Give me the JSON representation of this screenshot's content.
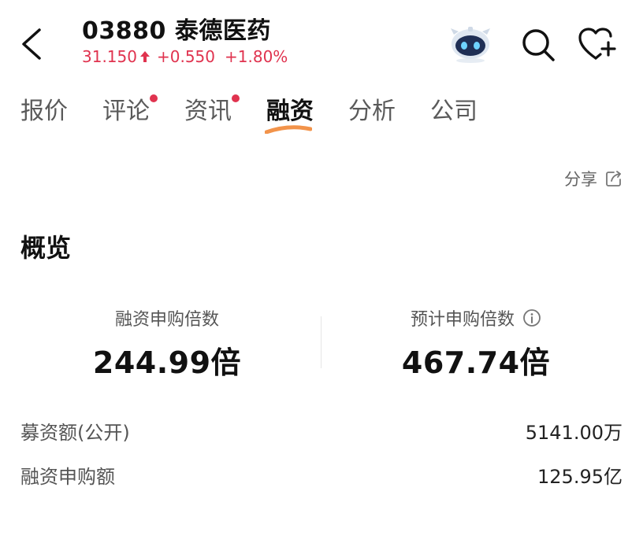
{
  "header": {
    "stock_code": "03880",
    "stock_name": "泰德医药",
    "price": "31.150",
    "change": "+0.550",
    "change_pct": "+1.80%",
    "quote_color": "#e0334f"
  },
  "icons": {
    "back": "chevron-left-icon",
    "assistant": "robot-assistant-icon",
    "search": "search-icon",
    "favorite": "heart-plus-icon",
    "share": "share-icon",
    "info": "info-icon"
  },
  "tabs": [
    {
      "label": "报价",
      "active": false,
      "dot": false
    },
    {
      "label": "评论",
      "active": false,
      "dot": true
    },
    {
      "label": "资讯",
      "active": false,
      "dot": true
    },
    {
      "label": "融资",
      "active": true,
      "dot": false
    },
    {
      "label": "分析",
      "active": false,
      "dot": false
    },
    {
      "label": "公司",
      "active": false,
      "dot": false
    }
  ],
  "share_label": "分享",
  "overview": {
    "title": "概览",
    "stats": [
      {
        "label": "融资申购倍数",
        "value": "244.99倍"
      },
      {
        "label": "预计申购倍数",
        "value": "467.74倍"
      }
    ],
    "rows": [
      {
        "key": "募资额(公开)",
        "value": "5141.00万"
      },
      {
        "key": "融资申购额",
        "value": "125.95亿"
      }
    ]
  }
}
